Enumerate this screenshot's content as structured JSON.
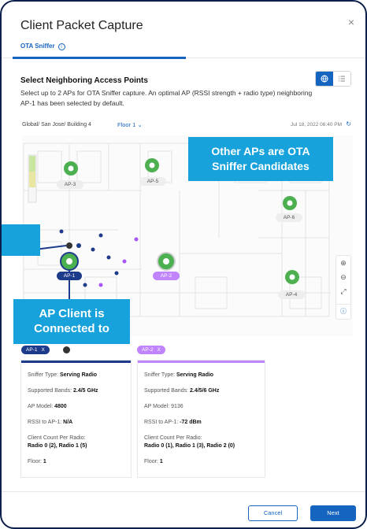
{
  "dialog": {
    "title": "Client Packet Capture",
    "close_glyph": "×"
  },
  "tabs": [
    {
      "label": "OTA Sniffer",
      "active": true
    }
  ],
  "section": {
    "title": "Select Neighboring Access Points",
    "description": "Select up to 2 APs for OTA Sniffer capture. An optimal AP (RSSI strength + radio type) neighboring AP-1 has been selected by default."
  },
  "location": {
    "breadcrumb": "Global/ San Jose/ Building 4",
    "floor": "Floor 1",
    "timestamp": "Jul 18, 2022 06:40 PM"
  },
  "map": {
    "aps": [
      {
        "label": "AP-1",
        "state": "connected"
      },
      {
        "label": "AP-2",
        "state": "selected"
      },
      {
        "label": "AP-3",
        "state": "candidate"
      },
      {
        "label": "AP-4",
        "state": "candidate"
      },
      {
        "label": "AP-5",
        "state": "candidate"
      },
      {
        "label": "AP-6",
        "state": "candidate"
      }
    ]
  },
  "callouts": {
    "top": [
      "Other APs are OTA",
      "Sniffer Candidates"
    ],
    "bottom": [
      "AP Client is",
      "Connected to"
    ]
  },
  "selected_chips": [
    {
      "label": "AP-1",
      "x": "X"
    },
    {
      "label": "AP-2",
      "x": "X"
    }
  ],
  "cards": [
    {
      "sniffer_type_label": "Sniffer Type:",
      "sniffer_type": "Serving Radio",
      "bands_label": "Supported Bands:",
      "bands": "2.4/5 GHz",
      "model_label": "AP Model:",
      "model": "4800",
      "rssi_label": "RSSI to AP-1:",
      "rssi": "N/A",
      "client_count_label": "Client Count Per Radio:",
      "client_count": "Radio 0 (2), Radio 1 (5)",
      "floor_label": "Floor:",
      "floor": "1"
    },
    {
      "sniffer_type_label": "Sniffer Type:",
      "sniffer_type": "Serving Radio",
      "bands_label": "Supported Bands:",
      "bands": "2.4/5/6 GHz",
      "model_label": "AP Model:",
      "model": "9136",
      "rssi_label": "RSSI to AP-1:",
      "rssi": "-72 dBm",
      "client_count_label": "Client Count Per Radio:",
      "client_count": "Radio 0 (1), Radio 1 (3), Radio 2 (0)",
      "floor_label": "Floor:",
      "floor": "1"
    }
  ],
  "buttons": {
    "cancel": "Cancel",
    "next": "Next"
  },
  "colors": {
    "accent": "#1565c0",
    "callout": "#17a2dc",
    "ap1": "#1e3a8a",
    "ap2": "#a855f7",
    "ap_candidate": "#4caf50"
  }
}
